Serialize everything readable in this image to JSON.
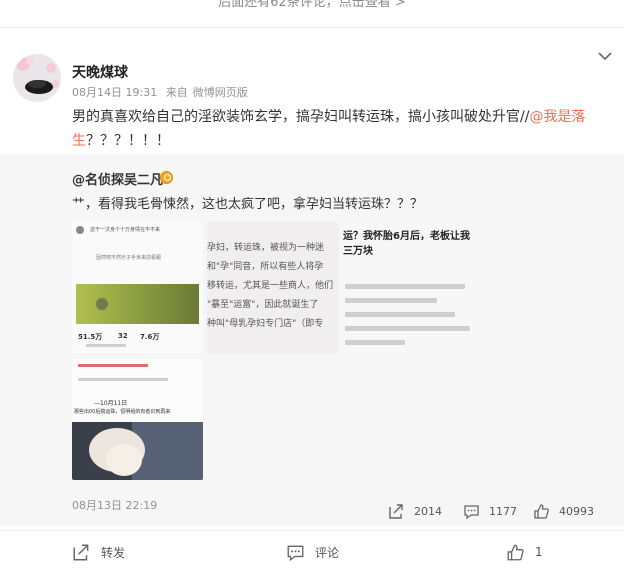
{
  "top_notice": "后面还有62条评论，点击查看 >",
  "post": {
    "username": "天晚煤球",
    "time": "08月14日 19:31",
    "source_prefix": "来自",
    "source": "微博网页版",
    "text_before": "男的真喜欢给自己的淫欲装饰玄学，搞孕妇叫转运珠，搞小孩叫破处升官//",
    "mention": "@我是落生",
    "text_after": "？？？！！！"
  },
  "repost": {
    "username": "@名侦探吴二凡",
    "text": "艹，看得我毛骨悚然，这也太疯了吧，拿孕妇当转运珠？？？",
    "time": "08月13日 22:19",
    "share_count": "2014",
    "comment_count": "1177",
    "like_count": "40993",
    "thumbs": {
      "t1": {
        "lines": [
          "这干一汶身个十万身情在不不来",
          "因然吧不然乐子手米来前看跟"
        ],
        "stats": [
          "51.5万",
          "32",
          "7.6万"
        ]
      },
      "t2": {
        "lines": [
          "孕妇，转运珠，被视为一种迷",
          "和\"孕\"同音，所以有些人将孕",
          "移转运，尤其是一些商人，他们",
          "\"暴至\"运富\"，因此就诞生了",
          "种叫\"母乳孕妇专门店\"（即专"
        ]
      },
      "t3": {
        "lines": [
          "运？我怀胎6月后，老板让我",
          "三万块"
        ]
      },
      "t4": {
        "lines": [
          "—10月11日",
          "那些出00后搞运珠，恒明组的有者识到再来"
        ]
      }
    }
  },
  "actions": {
    "share_label": "转发",
    "comment_label": "评论",
    "like_count": "1"
  },
  "colors": {
    "mention": "#eb7350",
    "repost_bg": "#f6f6f6",
    "meta_gray": "#939393"
  },
  "icons": [
    "chevron-down-icon",
    "verified-badge-icon",
    "share-icon",
    "comment-icon",
    "like-icon"
  ]
}
